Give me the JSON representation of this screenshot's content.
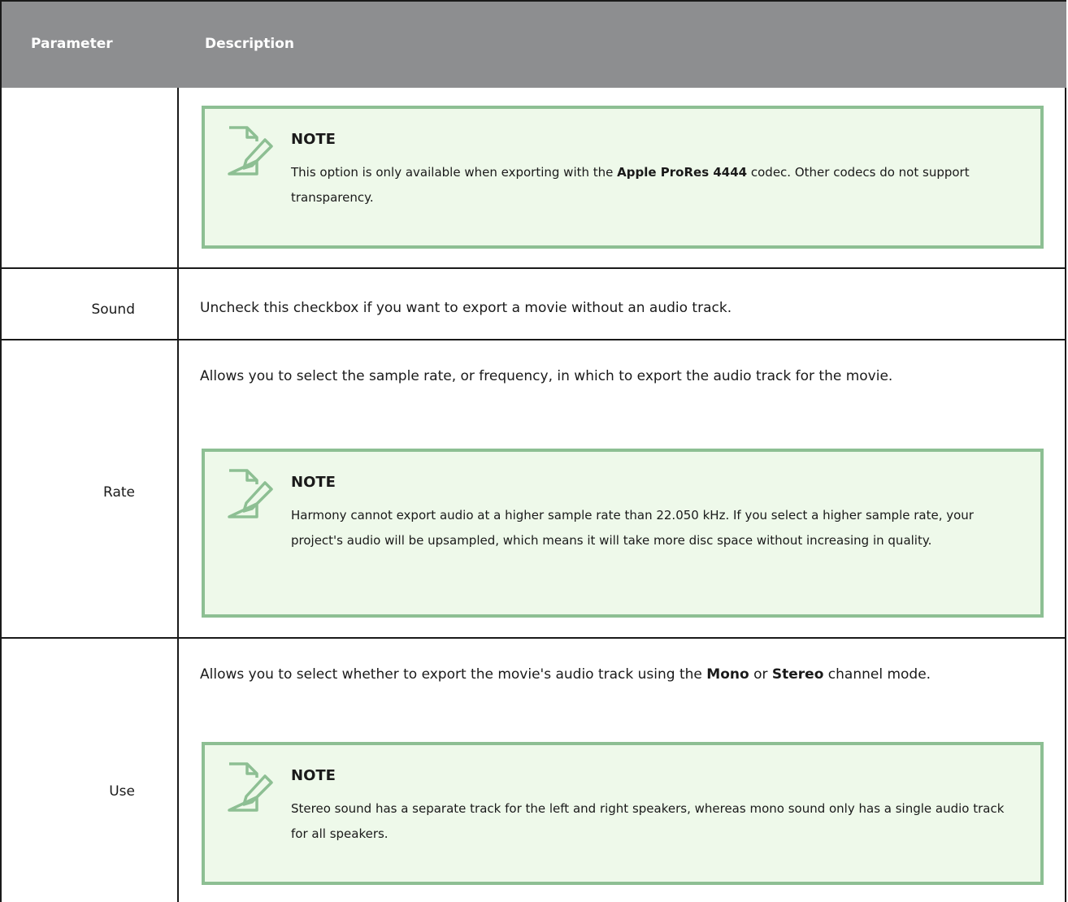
{
  "header": {
    "parameter": "Parameter",
    "description": "Description"
  },
  "note_label": "NOTE",
  "rows": {
    "first": {
      "note": {
        "pre": "This option is only available when exporting with the ",
        "bold": "Apple ProRes 4444",
        "post": " codec. Other codecs do not support transparency."
      }
    },
    "sound": {
      "param": "Sound",
      "desc": "Uncheck this checkbox if you want to export a movie without an audio track."
    },
    "rate": {
      "param": "Rate",
      "desc": "Allows you to select the sample rate, or frequency, in which to export the audio track for the movie.",
      "note": "Harmony cannot export audio at a higher sample rate than 22.050 kHz. If you select a higher sample rate, your project's audio will be upsampled, which means it will take more disc space without increasing in quality."
    },
    "use": {
      "param": "Use",
      "desc": {
        "pre": "Allows you to select whether to export the movie's audio track using the ",
        "bold1": "Mono",
        "mid": " or ",
        "bold2": "Stereo",
        "post": " channel mode."
      },
      "note": "Stereo sound has a separate track for the left and right speakers, whereas mono sound only has a single audio track for all speakers."
    }
  },
  "colors": {
    "header_bg": "#8d8e90",
    "note_bg": "#eef9ea",
    "note_border": "#8dbf93"
  },
  "icons": {
    "note": "note-pencil-icon"
  }
}
